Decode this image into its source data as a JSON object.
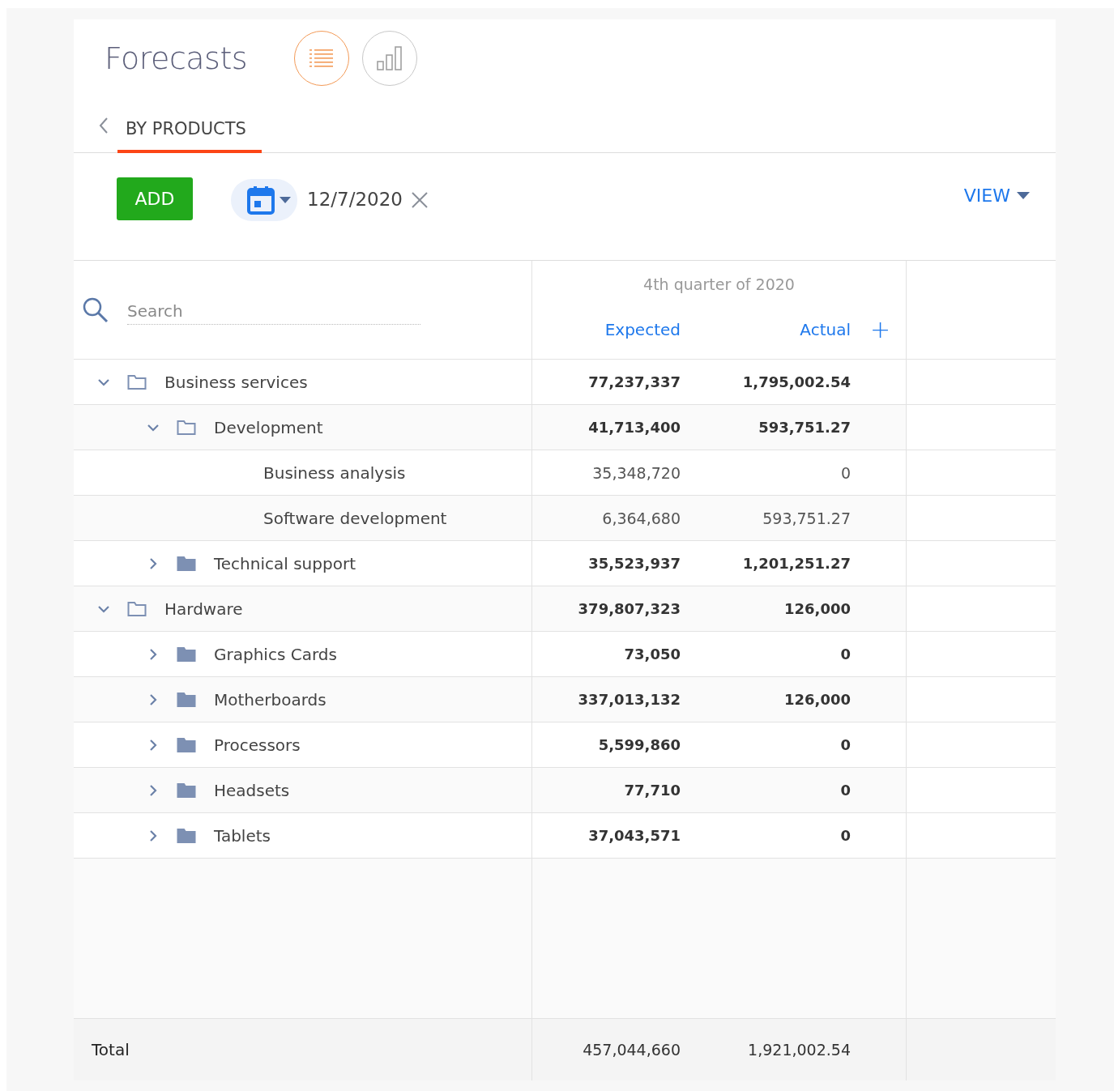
{
  "title": "Forecasts",
  "view_toggle": [
    {
      "kind": "list",
      "selected": true
    },
    {
      "kind": "chart",
      "selected": false
    }
  ],
  "tab": {
    "label": "BY PRODUCTS",
    "selected": true
  },
  "toolbar": {
    "add_button": "ADD",
    "date": "12/7/2020",
    "view_button": "VIEW"
  },
  "search": {
    "placeholder": "Search"
  },
  "period": "4th quarter of 2020",
  "columns": [
    "Expected",
    "Actual"
  ],
  "add_column": "+",
  "rows": [
    {
      "name": "Business services",
      "expanded": true,
      "expected": "77,237,337",
      "actual": "1,795,002.54",
      "children": [
        {
          "name": "Development",
          "expanded": true,
          "expected": "41,713,400",
          "actual": "593,751.27",
          "children": [
            {
              "name": "Business analysis",
              "expected": "35,348,720",
              "actual": "0"
            },
            {
              "name": "Software development",
              "expected": "6,364,680",
              "actual": "593,751.27"
            }
          ]
        },
        {
          "name": "Technical support",
          "expanded": false,
          "expected": "35,523,937",
          "actual": "1,201,251.27"
        }
      ]
    },
    {
      "name": "Hardware",
      "expanded": true,
      "expected": "379,807,323",
      "actual": "126,000",
      "children": [
        {
          "name": "Graphics Cards",
          "expanded": false,
          "expected": "73,050",
          "actual": "0"
        },
        {
          "name": "Motherboards",
          "expanded": false,
          "expected": "337,013,132",
          "actual": "126,000"
        },
        {
          "name": "Processors",
          "expanded": false,
          "expected": "5,599,860",
          "actual": "0"
        },
        {
          "name": "Headsets",
          "expanded": false,
          "expected": "77,710",
          "actual": "0"
        },
        {
          "name": "Tablets",
          "expanded": false,
          "expected": "37,043,571",
          "actual": "0"
        }
      ]
    }
  ],
  "total": {
    "label": "Total",
    "expected": "457,044,660",
    "actual": "1,921,002.54"
  }
}
